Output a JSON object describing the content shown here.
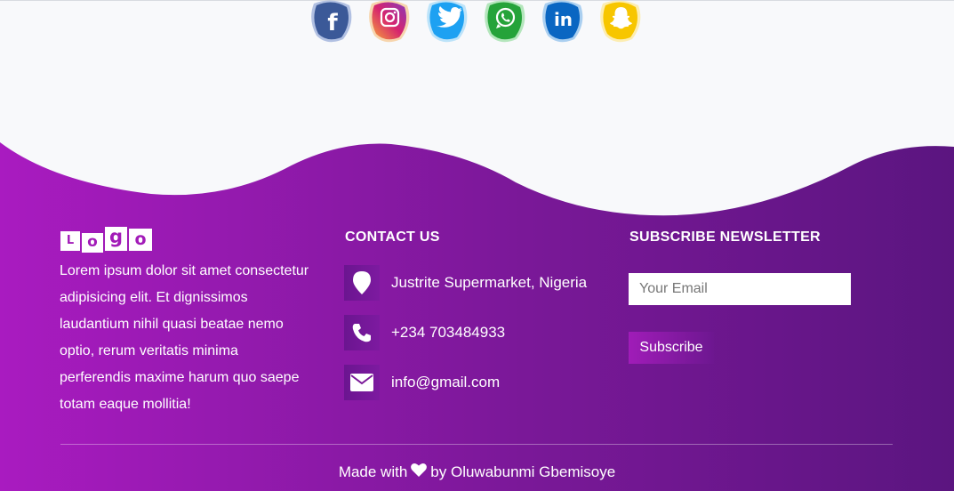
{
  "colors": {
    "gradient_start": "#a91bc0",
    "gradient_end": "#5b1580",
    "page_bg": "#f8f9fb"
  },
  "social": [
    {
      "icon": "facebook-icon",
      "glyph": "f",
      "color": "#3b5998",
      "accent": "#6a87c9"
    },
    {
      "icon": "instagram-icon",
      "glyph": "",
      "color": "#d6246e",
      "accent": "#f6a13a"
    },
    {
      "icon": "twitter-icon",
      "glyph": "",
      "color": "#1da1f2",
      "accent": "#7fcdf7"
    },
    {
      "icon": "whatsapp-icon",
      "glyph": "",
      "color": "#25a33a",
      "accent": "#6fd47d"
    },
    {
      "icon": "linkedin-icon",
      "glyph": "in",
      "color": "#0a66c2",
      "accent": "#5ca6e6"
    },
    {
      "icon": "snapchat-icon",
      "glyph": "",
      "color": "#f7c600",
      "accent": "#ffe26a"
    }
  ],
  "logo": {
    "letters": [
      "L",
      "o",
      "g",
      "o"
    ]
  },
  "about": {
    "text": "Lorem ipsum dolor sit amet consectetur adipisicing elit. Et dignissimos laudantium nihil quasi beatae nemo optio, rerum veritatis minima perferendis maxime harum quo saepe totam eaque mollitia!"
  },
  "contact": {
    "title": "CONTACT US",
    "items": [
      {
        "icon": "location-icon",
        "text": "Justrite Supermarket, Nigeria"
      },
      {
        "icon": "phone-icon",
        "text": "+234 703484933"
      },
      {
        "icon": "envelope-icon",
        "text": "info@gmail.com"
      }
    ]
  },
  "newsletter": {
    "title": "SUBSCRIBE NEWSLETTER",
    "email_placeholder": "Your Email",
    "button_label": "Subscribe"
  },
  "credit": {
    "prefix": "Made with",
    "heart_icon": "heart-icon",
    "suffix": "by Oluwabunmi Gbemisoye"
  }
}
